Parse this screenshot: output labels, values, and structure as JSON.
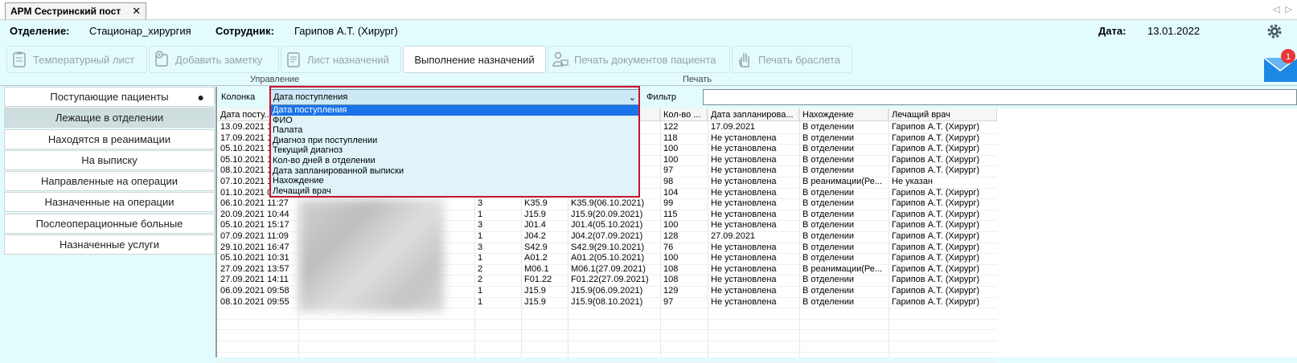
{
  "window_tab": {
    "title": "АРМ Сестринский пост",
    "close": "✕"
  },
  "tab_nav": "◁ ▷",
  "info": {
    "department_label": "Отделение:",
    "department_value": "Стационар_хирургия",
    "employee_label": "Сотрудник:",
    "employee_value": "Гарипов А.Т. (Хирург)",
    "date_label": "Дата:",
    "date_value": "13.01.2022"
  },
  "toolbar": {
    "temp_sheet": "Температурный лист",
    "add_note": "Добавить заметку",
    "prescriptions_list": "Лист назначений",
    "prescriptions_exec": "Выполнение назначений",
    "print_docs": "Печать документов пациента",
    "print_bracelet": "Печать браслета",
    "group_manage": "Управление",
    "group_print": "Печать"
  },
  "notification_count": "1",
  "sidebar": {
    "items": [
      {
        "label": "Поступающие пациенты"
      },
      {
        "label": "Лежащие в отделении"
      },
      {
        "label": "Находятся в реанимации"
      },
      {
        "label": "На выписку"
      },
      {
        "label": "Направленные на операции"
      },
      {
        "label": "Назначенные на операции"
      },
      {
        "label": "Послеоперационные больные"
      },
      {
        "label": "Назначенные услуги"
      }
    ]
  },
  "filter": {
    "column_label": "Колонка",
    "column_value": "Дата поступления",
    "filter_label": "Фильтр",
    "options": [
      "Дата поступления",
      "ФИО",
      "Палата",
      "Диагноз при поступлении",
      "Текущий диагноз",
      "Кол-во дней в отделении",
      "Дата запланированной выписки",
      "Нахождение",
      "Лечащий врач"
    ]
  },
  "table": {
    "headers": [
      "Дата посту...",
      "",
      "",
      "",
      "",
      "Кол-во ...",
      "Дата запланирова...",
      "Нахождение",
      "Лечащий врач"
    ],
    "rows": [
      [
        "13.09.2021 1",
        "",
        "",
        "",
        "",
        "122",
        "17.09.2021",
        "В отделении",
        "Гарипов А.Т. (Хирург)"
      ],
      [
        "17.09.2021 1",
        "",
        "",
        "",
        "",
        "118",
        "Не установлена",
        "В отделении",
        "Гарипов А.Т. (Хирург)"
      ],
      [
        "05.10.2021 1",
        "",
        "",
        "",
        "",
        "100",
        "Не установлена",
        "В отделении",
        "Гарипов А.Т. (Хирург)"
      ],
      [
        "05.10.2021 1",
        "",
        "",
        "",
        "",
        "100",
        "Не установлена",
        "В отделении",
        "Гарипов А.Т. (Хирург)"
      ],
      [
        "08.10.2021 1",
        "",
        "",
        "",
        "",
        "97",
        "Не установлена",
        "В отделении",
        "Гарипов А.Т. (Хирург)"
      ],
      [
        "07.10.2021 1",
        "",
        "",
        "",
        "",
        "98",
        "Не установлена",
        "В реанимации(Ре...",
        "Не указан"
      ],
      [
        "01.10.2021 0",
        "",
        "",
        "",
        "",
        "104",
        "Не установлена",
        "В отделении",
        "Гарипов А.Т. (Хирург)"
      ],
      [
        "06.10.2021 11:27",
        "",
        "3",
        "K35.9",
        "K35.9(06.10.2021)",
        "99",
        "Не установлена",
        "В отделении",
        "Гарипов А.Т. (Хирург)"
      ],
      [
        "20.09.2021 10:44",
        "",
        "1",
        "J15.9",
        "J15.9(20.09.2021)",
        "115",
        "Не установлена",
        "В отделении",
        "Гарипов А.Т. (Хирург)"
      ],
      [
        "05.10.2021 15:17",
        "",
        "3",
        "J01.4",
        "J01.4(05.10.2021)",
        "100",
        "Не установлена",
        "В отделении",
        "Гарипов А.Т. (Хирург)"
      ],
      [
        "07.09.2021 11:09",
        "",
        "1",
        "J04.2",
        "J04.2(07.09.2021)",
        "128",
        "27.09.2021",
        "В отделении",
        "Гарипов А.Т. (Хирург)"
      ],
      [
        "29.10.2021 16:47",
        "",
        "3",
        "S42.9",
        "S42.9(29.10.2021)",
        "76",
        "Не установлена",
        "В отделении",
        "Гарипов А.Т. (Хирург)"
      ],
      [
        "05.10.2021 10:31",
        "",
        "1",
        "A01.2",
        "A01.2(05.10.2021)",
        "100",
        "Не установлена",
        "В отделении",
        "Гарипов А.Т. (Хирург)"
      ],
      [
        "27.09.2021 13:57",
        "",
        "2",
        "M06.1",
        "M06.1(27.09.2021)",
        "108",
        "Не установлена",
        "В реанимации(Ре...",
        "Гарипов А.Т. (Хирург)"
      ],
      [
        "27.09.2021 14:11",
        "",
        "2",
        "F01.22",
        "F01.22(27.09.2021)",
        "108",
        "Не установлена",
        "В отделении",
        "Гарипов А.Т. (Хирург)"
      ],
      [
        "06.09.2021 09:58",
        "",
        "1",
        "J15.9",
        "J15.9(06.09.2021)",
        "129",
        "Не установлена",
        "В отделении",
        "Гарипов А.Т. (Хирург)"
      ],
      [
        "08.10.2021 09:55",
        "",
        "1",
        "J15.9",
        "J15.9(08.10.2021)",
        "97",
        "Не установлена",
        "В отделении",
        "Гарипов А.Т. (Хирург)"
      ]
    ]
  },
  "colors": {
    "accent": "#1a73e8",
    "highlight": "#c8102e",
    "background": "#e2fbfd"
  }
}
